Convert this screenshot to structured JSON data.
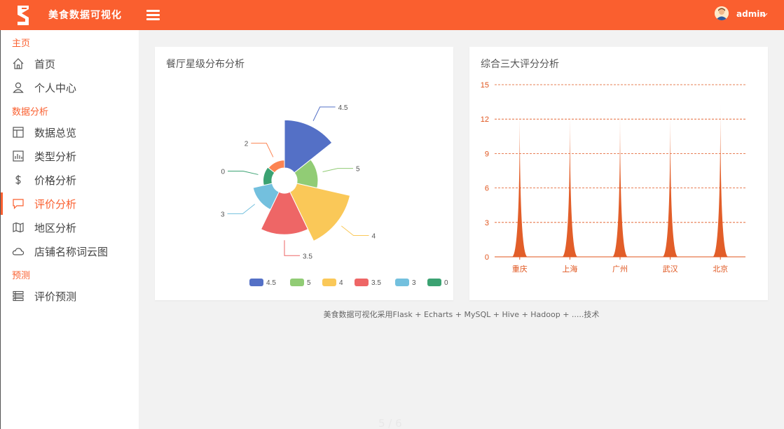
{
  "header": {
    "app_title": "美食数据可视化",
    "user_name": "admin"
  },
  "sidebar": {
    "sections": [
      {
        "label": "主页"
      },
      {
        "label": "数据分析"
      },
      {
        "label": "预测"
      }
    ],
    "items": [
      {
        "label": "首页",
        "icon": "home-icon"
      },
      {
        "label": "个人中心",
        "icon": "user-icon"
      },
      {
        "label": "数据总览",
        "icon": "layout-icon"
      },
      {
        "label": "类型分析",
        "icon": "bar-chart-icon"
      },
      {
        "label": "价格分析",
        "icon": "dollar-icon"
      },
      {
        "label": "评价分析",
        "icon": "comment-icon",
        "active": true
      },
      {
        "label": "地区分析",
        "icon": "map-icon"
      },
      {
        "label": "店铺名称词云图",
        "icon": "cloud-icon"
      },
      {
        "label": "评价预测",
        "icon": "list-icon"
      }
    ]
  },
  "colors": {
    "accent": "#fa5f2f"
  },
  "chart_data": [
    {
      "type": "pie",
      "title": "餐厅星级分布分析",
      "subtype": "nightingale-rose",
      "series": [
        {
          "name": "4.5",
          "value": 110,
          "color": "#5470c6"
        },
        {
          "name": "5",
          "value": 48,
          "color": "#91cc75"
        },
        {
          "name": "4",
          "value": 125,
          "color": "#fac858"
        },
        {
          "name": "3.5",
          "value": 95,
          "color": "#ee6666"
        },
        {
          "name": "3",
          "value": 45,
          "color": "#73c0de"
        },
        {
          "name": "0",
          "value": 20,
          "color": "#3ba272"
        },
        {
          "name": "2",
          "value": 18,
          "color": "#fc8452"
        }
      ],
      "legend_position": "bottom-right"
    },
    {
      "type": "bar",
      "subtype": "pictorial-spike",
      "title": "综合三大评分分析",
      "categories": [
        "重庆",
        "上海",
        "广州",
        "武汉",
        "北京"
      ],
      "values": [
        12.8,
        12.8,
        12.7,
        12.7,
        13.3
      ],
      "ylim": [
        0,
        15
      ],
      "yticks": [
        0,
        3,
        6,
        9,
        12,
        15
      ],
      "grid": true,
      "color": "#e0551e"
    }
  ],
  "footer": {
    "text": "美食数据可视化采用Flask + Echarts + MySQL + Hive + Hadoop + .....技术"
  },
  "page_indicator": "5 / 6"
}
